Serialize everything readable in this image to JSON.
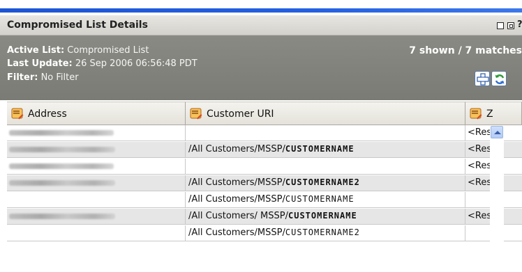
{
  "panel": {
    "title": "Compromised List Details",
    "help_glyph": "?"
  },
  "info": {
    "active_list_label": "Active List:",
    "active_list_value": "Compromised List",
    "last_update_label": "Last Update:",
    "last_update_value": "26 Sep 2006 06:56:48 PDT",
    "filter_label": "Filter:",
    "filter_value": "No Filter",
    "matches": "7 shown / 7 matches"
  },
  "table": {
    "columns": [
      {
        "label": "Address",
        "icon": "column-config-icon"
      },
      {
        "label": "Customer URI",
        "icon": "column-config-icon"
      },
      {
        "label": "Z",
        "icon": "column-config-icon"
      }
    ],
    "rows": [
      {
        "address_blurred": true,
        "customer_prefix": "",
        "customer_name": "",
        "zone": "<Reso"
      },
      {
        "address_blurred": true,
        "customer_prefix": "/All Customers/MSSP/",
        "customer_name": "CUSTOMERNAME",
        "zone": "<Reso"
      },
      {
        "address_blurred": true,
        "customer_prefix": "",
        "customer_name": "",
        "zone": "<Reso"
      },
      {
        "address_blurred": true,
        "customer_prefix": "/All Customers/MSSP/",
        "customer_name": "CUSTOMERNAME2",
        "zone": "<Reso"
      },
      {
        "address_blurred": false,
        "customer_prefix": "/All Customers/MSSP/",
        "customer_name": "CUSTOMERNAME",
        "zone": ""
      },
      {
        "address_blurred": true,
        "customer_prefix": "/All Customers/ MSSP/",
        "customer_name": "CUSTOMERNAME",
        "zone": "<Reso"
      },
      {
        "address_blurred": false,
        "customer_prefix": "/All Customers/MSSP/",
        "customer_name": "CUSTOMERNAME2",
        "zone": ""
      }
    ]
  },
  "colors": {
    "accent_blue": "#2460e0",
    "info_panel_bg": "#7f7f79",
    "alt_row_bg": "#e6e6e6"
  }
}
